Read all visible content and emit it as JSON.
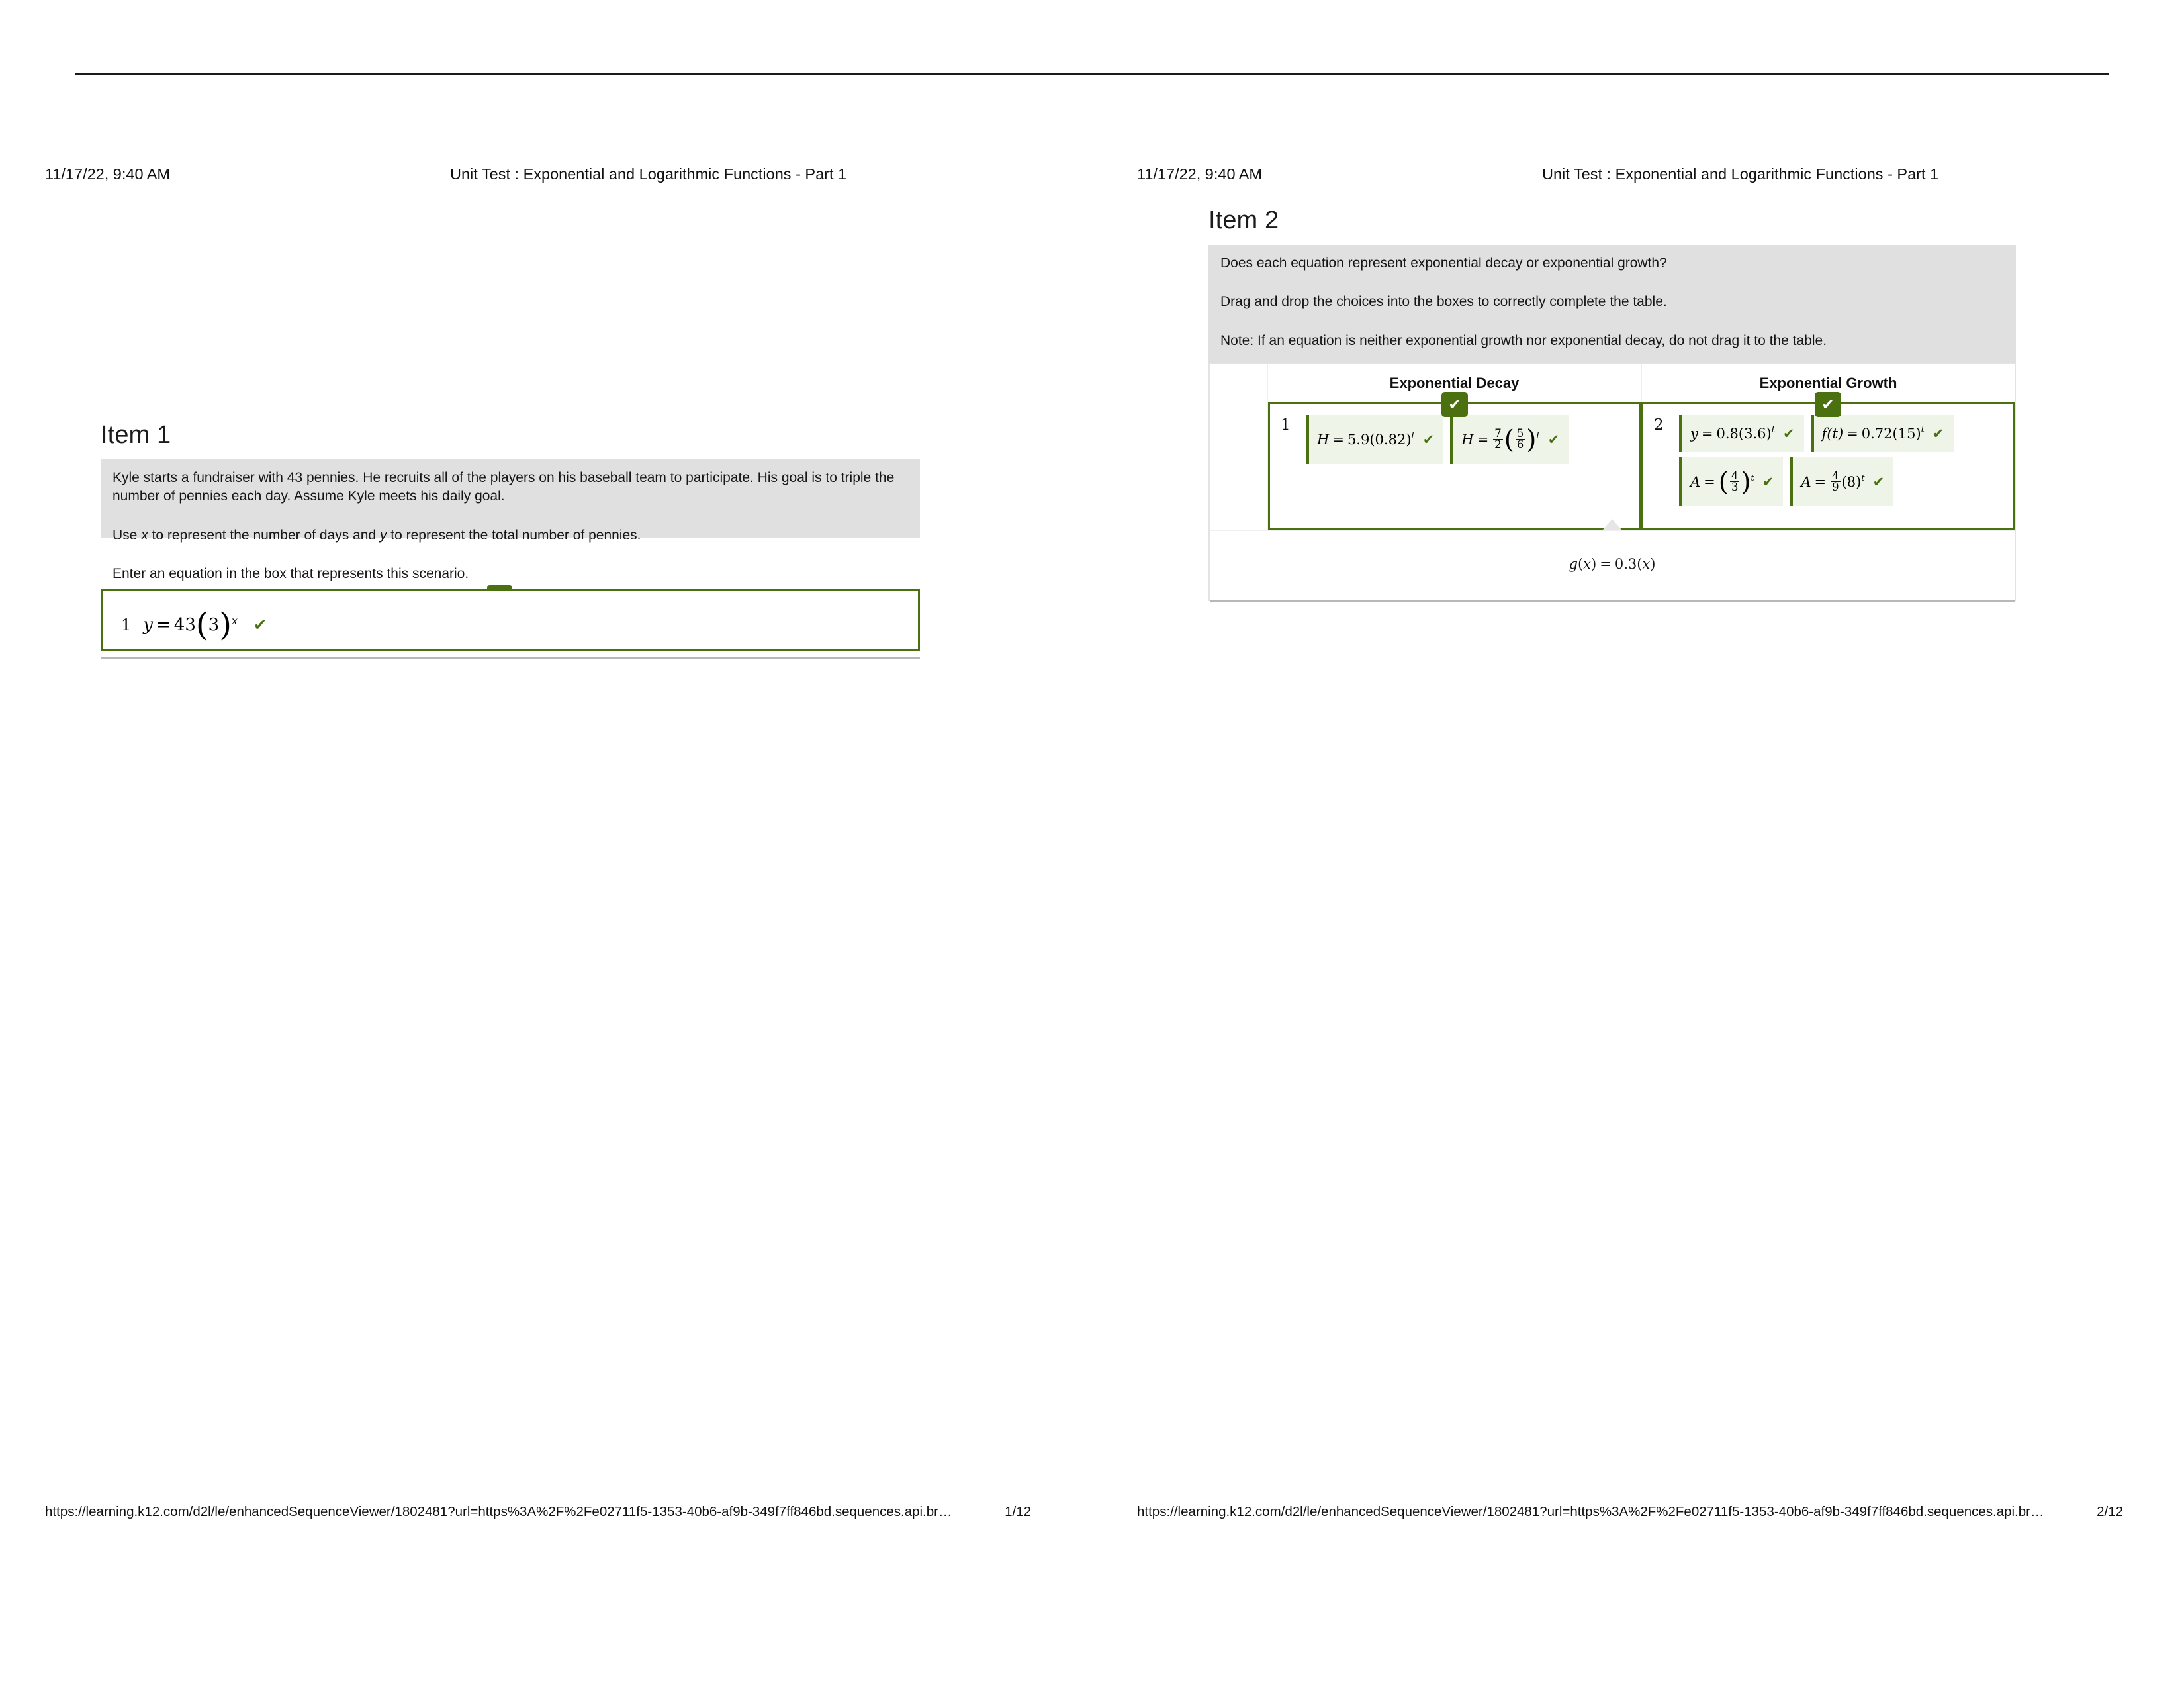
{
  "document": {
    "title": "Unit Test : Exponential and Logarithmic Functions - Part 1",
    "date": "11/17/22, 9:40 AM",
    "url": "https://learning.k12.com/d2l/le/enhancedSequenceViewer/1802481?url=https%3A%2F%2Fe02711f5-1353-40b6-af9b-349f7ff846bd.sequences.api.br…",
    "accent_color": "#4b7010",
    "passage_bg": "#e0e0e0",
    "tile_bg": "#eef5e8"
  },
  "pages": [
    {
      "number": "1/12"
    },
    {
      "number": "2/12"
    }
  ],
  "item1": {
    "title": "Item 1",
    "passage": [
      "Kyle starts a fundraiser with 43 pennies. He recruits all of the players on his baseball team to participate. His goal is to triple the number of pennies each day. Assume Kyle meets his daily goal.",
      "Use x to represent the number of days and y to represent the total number of pennies.",
      "Enter an equation in the box that represents this scenario."
    ],
    "answer": {
      "number": "1",
      "equation": "y = 43(3)^x",
      "equation_parts": {
        "lhs": "y",
        "eq": "=",
        "coefficient": "43",
        "base": "3",
        "exponent": "x"
      },
      "correct": true,
      "status_icon": "checkmark-icon"
    }
  },
  "item2": {
    "title": "Item 2",
    "passage": [
      "Does each equation represent exponential decay or exponential growth?",
      "Drag and drop the choices into the boxes to correctly complete the table.",
      "Note: If an equation is neither exponential growth nor exponential decay, do not drag it to the table."
    ],
    "columns": [
      {
        "header": "Exponential Decay",
        "zone_number": "1",
        "correct": true,
        "status_icon": "checkmark-icon"
      },
      {
        "header": "Exponential Growth",
        "zone_number": "2",
        "correct": true,
        "status_icon": "checkmark-icon"
      }
    ],
    "decay_tiles": [
      {
        "id": "decay-tile-1",
        "equation": "H = 5.9(0.82)^t",
        "lhs": "H",
        "coefficient": "5.9",
        "base": "0.82",
        "exponent": "t",
        "correct": true
      },
      {
        "id": "decay-tile-2",
        "equation": "H = (7/2)(5/6)^t",
        "lhs": "H",
        "coef_num": "7",
        "coef_den": "2",
        "base_num": "5",
        "base_den": "6",
        "exponent": "t",
        "correct": true
      }
    ],
    "growth_tiles": [
      {
        "id": "growth-tile-1",
        "equation": "y = 0.8(3.6)^t",
        "lhs": "y",
        "coefficient": "0.8",
        "base": "3.6",
        "exponent": "t",
        "correct": true
      },
      {
        "id": "growth-tile-2",
        "equation": "f(t) = 0.72(15)^t",
        "lhs": "f(t)",
        "coefficient": "0.72",
        "base": "15",
        "exponent": "t",
        "correct": true
      },
      {
        "id": "growth-tile-3",
        "equation": "A = (4/3)^t",
        "lhs": "A",
        "base_num": "4",
        "base_den": "3",
        "exponent": "t",
        "correct": true
      },
      {
        "id": "growth-tile-4",
        "equation": "A = (4/9)(8)^t",
        "lhs": "A",
        "coef_num": "4",
        "coef_den": "9",
        "base": "8",
        "exponent": "t",
        "correct": true
      }
    ],
    "unused_choices": [
      {
        "id": "bank-tile-1",
        "equation": "g(x) = 0.3(x)",
        "lhs": "g(x)",
        "coefficient": "0.3",
        "arg": "x"
      }
    ]
  }
}
